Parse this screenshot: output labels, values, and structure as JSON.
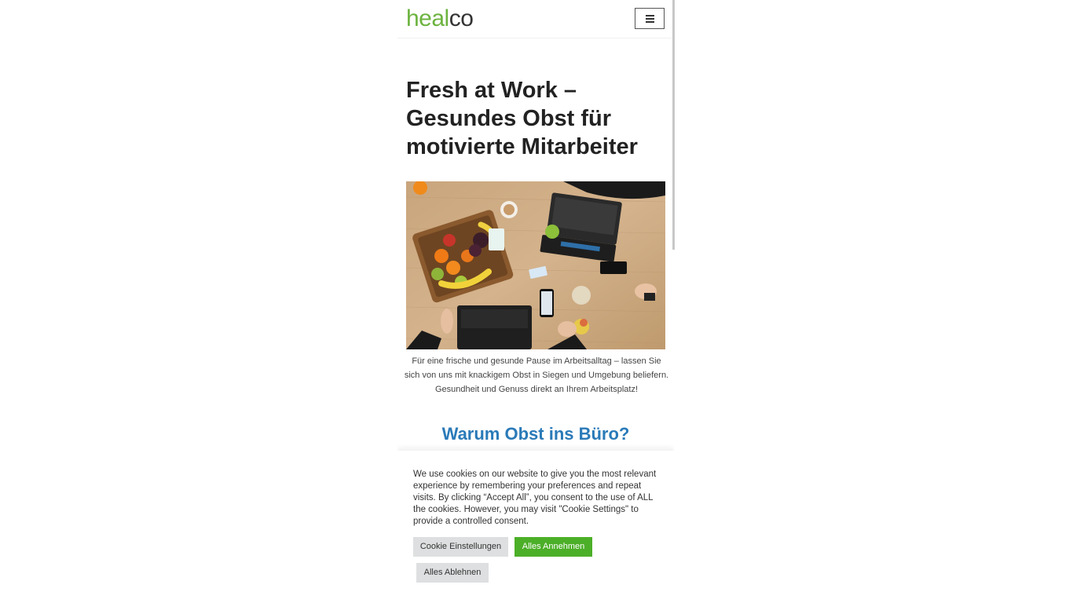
{
  "header": {
    "logo_part1": "heal",
    "logo_part2": "co",
    "menu_icon": "hamburger-menu-icon"
  },
  "hero": {
    "title": "Fresh at Work – Gesundes Obst für motivierte Mitarbeiter",
    "image_icon": "fruit-basket-office-photo",
    "intro": "Für eine frische und gesunde Pause im Arbeitsalltag – lassen Sie sich von uns mit knackigem Obst in Siegen und Umgebung beliefern. Gesundheit und Genuss direkt an Ihrem Arbeitsplatz!"
  },
  "section": {
    "title": "Warum Obst ins Büro?"
  },
  "cookie_banner": {
    "text": "We use cookies on our website to give you the most relevant experience by remembering your preferences and repeat visits. By clicking “Accept All”, you consent to the use of ALL the cookies. However, you may visit \"Cookie Settings\" to provide a controlled consent.",
    "settings_label": "Cookie Einstellungen",
    "accept_label": "Alles Annehmen",
    "reject_label": "Alles Ablehnen"
  },
  "colors": {
    "brand_green": "#6cb33f",
    "accept_green": "#4caf28",
    "heading_blue": "#2a7ab8"
  }
}
